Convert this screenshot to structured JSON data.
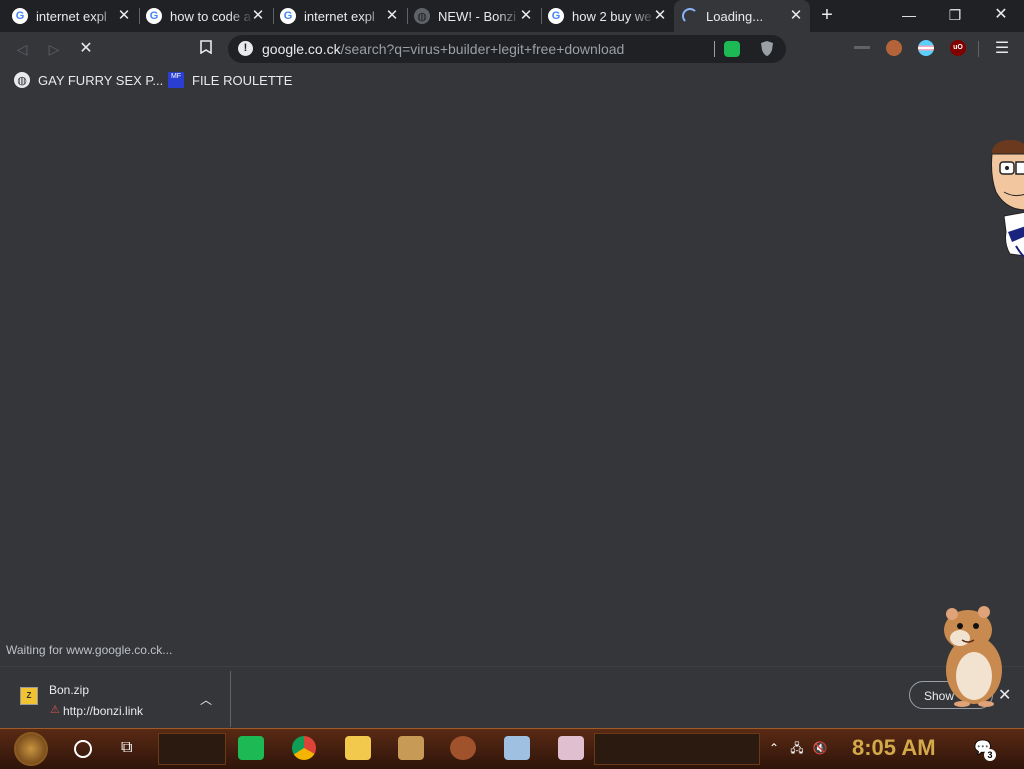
{
  "tabs": [
    {
      "title": "internet expl",
      "icon": "google-icon"
    },
    {
      "title": "how to code a",
      "icon": "google-icon"
    },
    {
      "title": "internet expl",
      "icon": "google-icon"
    },
    {
      "title": "NEW! - Bonzi",
      "icon": "globe-icon"
    },
    {
      "title": "how 2 buy we",
      "icon": "google-icon"
    },
    {
      "title": "Loading...",
      "icon": "loading-spinner-icon",
      "active": true
    }
  ],
  "omnibox": {
    "host": "google.co.ck",
    "path": "/search?q=virus+builder+legit+free+download"
  },
  "bookmarks": [
    {
      "label": "GAY FURRY SEX P...",
      "icon": "globe-icon"
    },
    {
      "label": "FILE ROULETTE",
      "icon": "file-roulette-icon",
      "icon_text": "MF"
    }
  ],
  "status_text": "Waiting for www.google.co.ck...",
  "download": {
    "filename": "Bon.zip",
    "url": "http://bonzi.link"
  },
  "download_shelf": {
    "show_all_label": "Show"
  },
  "taskbar": {
    "clock": "8:05 AM",
    "notification_count": "3"
  },
  "colors": {
    "page_bg": "#35363a",
    "tabstrip_bg": "#202124",
    "omnibox_bg": "#202124",
    "clock": "#d4a94a",
    "taskbar": "#5a2a14"
  }
}
